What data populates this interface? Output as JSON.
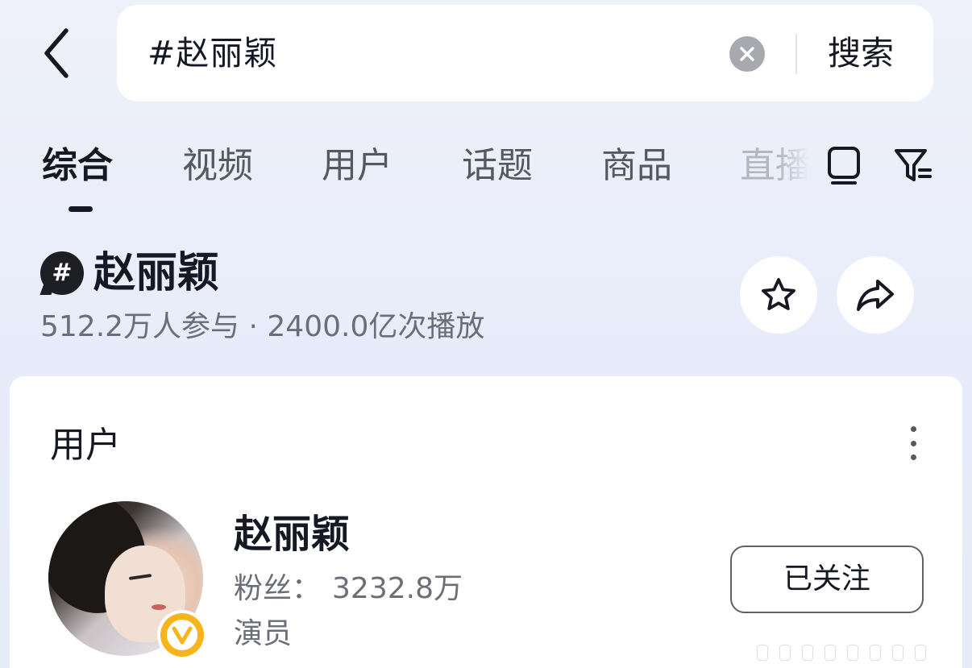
{
  "search": {
    "query": "#赵丽颖",
    "submit_label": "搜索"
  },
  "tabs": [
    {
      "label": "综合",
      "active": true
    },
    {
      "label": "视频",
      "active": false
    },
    {
      "label": "用户",
      "active": false
    },
    {
      "label": "话题",
      "active": false
    },
    {
      "label": "商品",
      "active": false
    },
    {
      "label": "直播",
      "active": false
    }
  ],
  "topic": {
    "name": "赵丽颖",
    "badge_symbol": "#",
    "stats": "512.2万人参与 · 2400.0亿次播放"
  },
  "user_section": {
    "title": "用户",
    "user": {
      "name": "赵丽颖",
      "fans_label": "粉丝：",
      "fans_count": "3232.8万",
      "role": "演员",
      "verified_badge": "V",
      "follow_label": "已关注"
    }
  },
  "colors": {
    "background": "#e9edf9",
    "text_primary": "#161823",
    "text_secondary": "#6b6e76",
    "verified_gold": "#f7b51d"
  },
  "icons": [
    "chevron-left-icon",
    "clear-icon",
    "collection-icon",
    "filter-icon",
    "hashtag-icon",
    "star-icon",
    "share-icon",
    "more-vertical-icon",
    "verified-v-icon"
  ]
}
